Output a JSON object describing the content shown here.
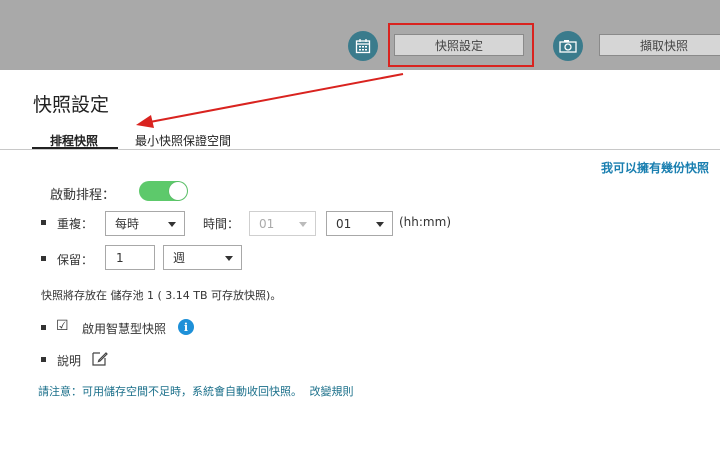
{
  "toolbar": {
    "calendar_icon": "calendar-icon",
    "snapshot_settings_label": "快照設定",
    "camera_icon": "camera-icon",
    "take_snapshot_label": "擷取快照"
  },
  "dialog": {
    "title": "快照設定",
    "tabs": [
      "排程快照",
      "最小快照保證空間"
    ],
    "help_link": "我可以擁有幾份快照"
  },
  "schedule": {
    "enable_label": "啟動排程：",
    "enabled": true,
    "repeat_label": "重複：",
    "repeat_value": "每時",
    "time_label": "時間：",
    "hour_value": "01",
    "minute_value": "01",
    "time_format": "(hh:mm)",
    "retain_label": "保留：",
    "retain_value": "1",
    "retain_unit": "週"
  },
  "storage_text": "快照將存放在 儲存池 1 ( 3.14 TB 可存放快照)。",
  "smart_snapshot": {
    "checkbox": "☑",
    "label": "啟用智慧型快照",
    "info": "i"
  },
  "description_label": "說明",
  "notice": {
    "text": "請注意：可用儲存空間不足時，系統會自動收回快照。",
    "link": "改變規則"
  },
  "colors": {
    "topbar": "#a9a9a9",
    "highlight": "#d9231f",
    "toggle_on": "#5dc96b",
    "link": "#1a7fb0",
    "icon_bg": "#3a7b8c"
  }
}
